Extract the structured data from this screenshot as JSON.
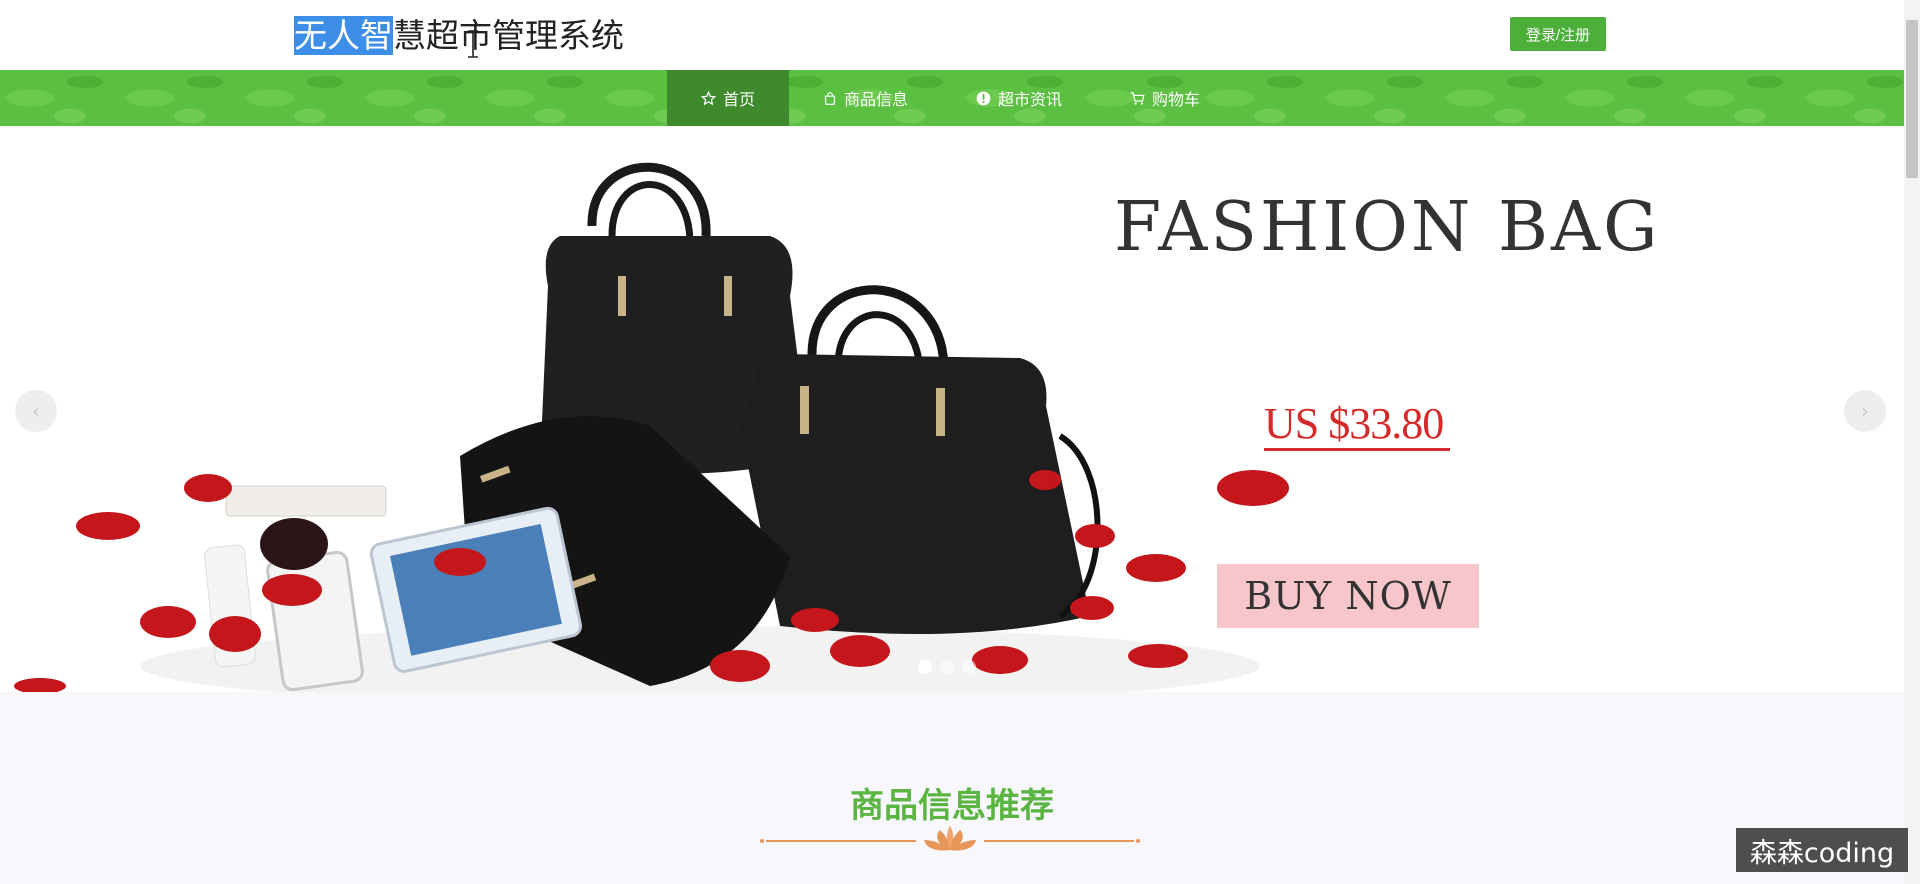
{
  "header": {
    "title_selected": "无人智",
    "title_rest": "慧超市管理系统",
    "login_label": "登录/注册"
  },
  "nav": {
    "items": [
      {
        "label": "首页",
        "icon": "star-icon",
        "active": true
      },
      {
        "label": "商品信息",
        "icon": "bag-icon",
        "active": false
      },
      {
        "label": "超市资讯",
        "icon": "info-icon",
        "active": false
      },
      {
        "label": "购物车",
        "icon": "cart-icon",
        "active": false
      }
    ]
  },
  "banner": {
    "headline": "FASHION BAG",
    "price": "US $33.80",
    "cta": "BUY NOW",
    "slides_total": 3,
    "active_slide": 1
  },
  "section": {
    "title": "商品信息推荐"
  },
  "watermark": "森森coding",
  "colors": {
    "brand_green": "#5bbf41",
    "nav_active": "#3f8a2c",
    "price_red": "#d62a2a",
    "cta_pink": "#f7c6cb",
    "selection_blue": "#3d8ee8",
    "divider_orange": "#e8955a"
  }
}
